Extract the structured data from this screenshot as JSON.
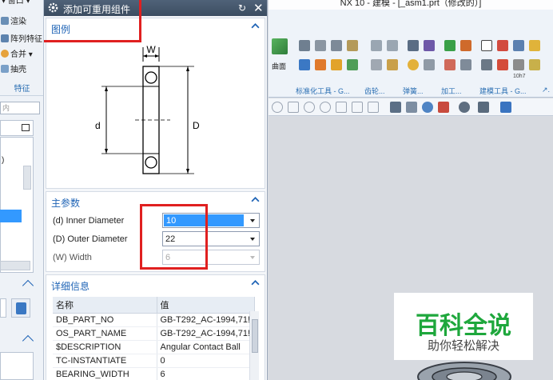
{
  "main_window": {
    "title": "NX 10 - 建模 - [_asm1.prt（修改的）]"
  },
  "left_toolbar": {
    "items": [
      "渲染",
      "阵列特征",
      "合并",
      "抽壳"
    ],
    "group_label": "特征",
    "filter_placeholder": "内",
    "list_row_value": ")"
  },
  "ribbon": {
    "surface_label": "曲面",
    "groups": [
      "标准化工具 - G...",
      "齿轮...",
      "弹簧...",
      "加工...",
      "建模工具 - G...",
      "↗."
    ],
    "small_label": "10h7"
  },
  "dialog": {
    "title": "添加可重用组件",
    "legend_group": {
      "label": "图例",
      "diagram": {
        "width_label": "W",
        "inner_label": "d",
        "outer_label": "D"
      }
    },
    "main_params": {
      "label": "主参数",
      "params": [
        {
          "label": "(d) Inner Diameter",
          "value": "10",
          "state": "selected"
        },
        {
          "label": "(D) Outer Diameter",
          "value": "22",
          "state": "normal"
        },
        {
          "label": "(W) Width",
          "value": "6",
          "state": "disabled"
        }
      ]
    },
    "details": {
      "label": "详细信息",
      "columns": [
        "名称",
        "值"
      ],
      "rows": [
        [
          "DB_PART_NO",
          "GB-T292_AC-1994,71!"
        ],
        [
          "OS_PART_NAME",
          "GB-T292_AC-1994,71!"
        ],
        [
          "$DESCRIPTION",
          "Angular Contact Ball"
        ],
        [
          "TC-INSTANTIATE",
          "0"
        ],
        [
          "BEARING_WIDTH",
          "6"
        ]
      ]
    }
  },
  "watermark": {
    "title": "百科全说",
    "subtitle": "助你轻松解决"
  },
  "colors": {
    "accent": "#1f64b6",
    "selection": "#3399ff",
    "highlight_box": "#e02020",
    "watermark_green": "#1ea73c"
  }
}
